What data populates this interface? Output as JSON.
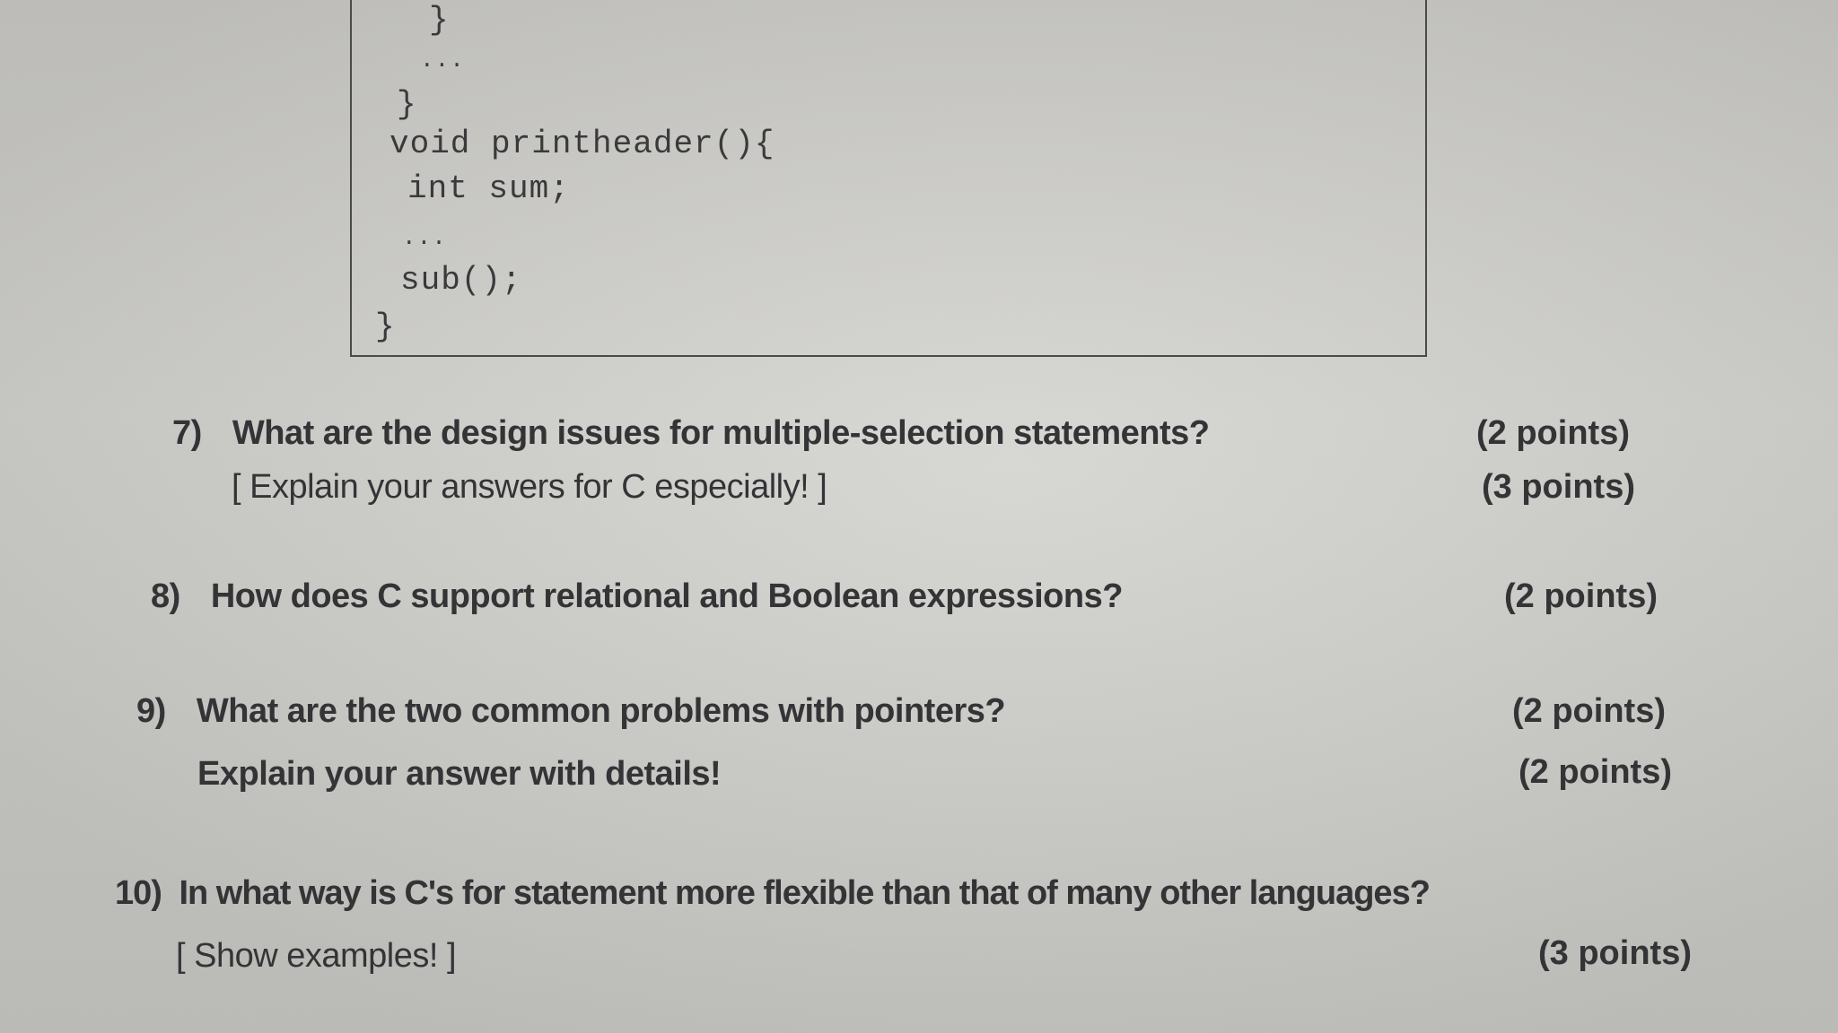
{
  "code": {
    "lines": [
      "}",
      "...",
      "}",
      "void printheader(){",
      "int sum;",
      "...",
      "sub();",
      "}"
    ]
  },
  "questions": [
    {
      "number": "7)",
      "text": "What are the design issues for multiple-selection statements?",
      "points": "(2 points)",
      "sub_text": "[ Explain your answers for C especially! ]",
      "sub_points": "(3 points)"
    },
    {
      "number": "8)",
      "text": "How does C support relational and Boolean expressions?",
      "points": "(2 points)"
    },
    {
      "number": "9)",
      "text": "What are the two common problems with pointers?",
      "points": "(2 points)",
      "sub_text": "Explain your answer with details!",
      "sub_points": "(2 points)"
    },
    {
      "number": "10)",
      "text": "In what way is C's for statement more flexible than that of many other languages?",
      "sub_text": "[ Show examples! ]",
      "sub_points": "(3 points)"
    }
  ]
}
